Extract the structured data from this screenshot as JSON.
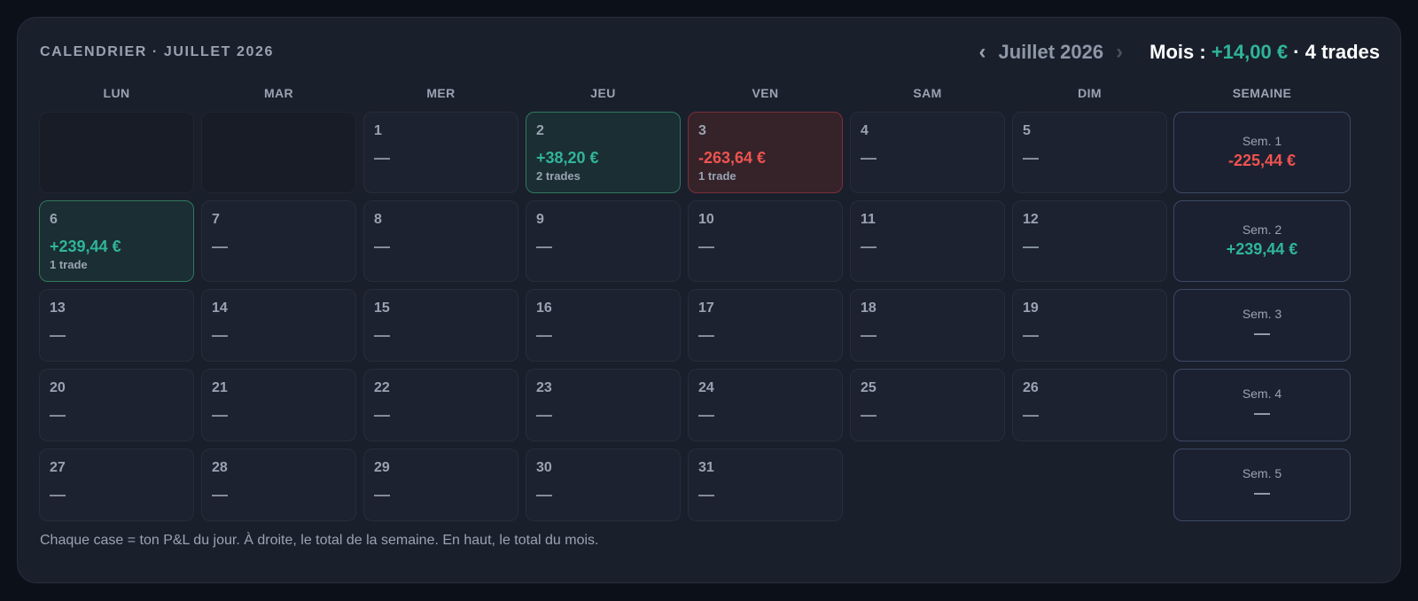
{
  "header": {
    "title": "CALENDRIER · JUILLET 2026",
    "prev_icon": "‹",
    "next_icon": "›",
    "month_label": "Juillet 2026",
    "summary_prefix": "Mois : ",
    "summary_pnl": "+14,00 €",
    "summary_suffix": " · 4 trades"
  },
  "weekdays": [
    "LUN",
    "MAR",
    "MER",
    "JEU",
    "VEN",
    "SAM",
    "DIM"
  ],
  "week_header": "SEMAINE",
  "colors": {
    "positive": "#2fb59a",
    "negative": "#ef5350",
    "background": "#0c1019",
    "card": "#1a1f2c"
  },
  "days": [
    {
      "n": "1",
      "pnl": "—",
      "trades": "",
      "status": "none"
    },
    {
      "n": "2",
      "pnl": "+38,20 €",
      "trades": "2 trades",
      "status": "win"
    },
    {
      "n": "3",
      "pnl": "-263,64 €",
      "trades": "1 trade",
      "status": "loss"
    },
    {
      "n": "4",
      "pnl": "—",
      "trades": "",
      "status": "none"
    },
    {
      "n": "5",
      "pnl": "—",
      "trades": "",
      "status": "none"
    },
    {
      "n": "6",
      "pnl": "+239,44 €",
      "trades": "1 trade",
      "status": "win"
    },
    {
      "n": "7",
      "pnl": "—",
      "trades": "",
      "status": "none"
    },
    {
      "n": "8",
      "pnl": "—",
      "trades": "",
      "status": "none"
    },
    {
      "n": "9",
      "pnl": "—",
      "trades": "",
      "status": "none"
    },
    {
      "n": "10",
      "pnl": "—",
      "trades": "",
      "status": "none"
    },
    {
      "n": "11",
      "pnl": "—",
      "trades": "",
      "status": "none"
    },
    {
      "n": "12",
      "pnl": "—",
      "trades": "",
      "status": "none"
    },
    {
      "n": "13",
      "pnl": "—",
      "trades": "",
      "status": "none"
    },
    {
      "n": "14",
      "pnl": "—",
      "trades": "",
      "status": "none"
    },
    {
      "n": "15",
      "pnl": "—",
      "trades": "",
      "status": "none"
    },
    {
      "n": "16",
      "pnl": "—",
      "trades": "",
      "status": "none"
    },
    {
      "n": "17",
      "pnl": "—",
      "trades": "",
      "status": "none"
    },
    {
      "n": "18",
      "pnl": "—",
      "trades": "",
      "status": "none"
    },
    {
      "n": "19",
      "pnl": "—",
      "trades": "",
      "status": "none"
    },
    {
      "n": "20",
      "pnl": "—",
      "trades": "",
      "status": "none"
    },
    {
      "n": "21",
      "pnl": "—",
      "trades": "",
      "status": "none"
    },
    {
      "n": "22",
      "pnl": "—",
      "trades": "",
      "status": "none"
    },
    {
      "n": "23",
      "pnl": "—",
      "trades": "",
      "status": "none"
    },
    {
      "n": "24",
      "pnl": "—",
      "trades": "",
      "status": "none"
    },
    {
      "n": "25",
      "pnl": "—",
      "trades": "",
      "status": "none"
    },
    {
      "n": "26",
      "pnl": "—",
      "trades": "",
      "status": "none"
    },
    {
      "n": "27",
      "pnl": "—",
      "trades": "",
      "status": "none"
    },
    {
      "n": "28",
      "pnl": "—",
      "trades": "",
      "status": "none"
    },
    {
      "n": "29",
      "pnl": "—",
      "trades": "",
      "status": "none"
    },
    {
      "n": "30",
      "pnl": "—",
      "trades": "",
      "status": "none"
    },
    {
      "n": "31",
      "pnl": "—",
      "trades": "",
      "status": "none"
    }
  ],
  "weeks": [
    {
      "label": "Sem. 1",
      "value": "-225,44 €",
      "status": "neg"
    },
    {
      "label": "Sem. 2",
      "value": "+239,44 €",
      "status": "pos"
    },
    {
      "label": "Sem. 3",
      "value": "—",
      "status": "none"
    },
    {
      "label": "Sem. 4",
      "value": "—",
      "status": "none"
    },
    {
      "label": "Sem. 5",
      "value": "—",
      "status": "none"
    }
  ],
  "footnote": "Chaque case = ton P&L du jour. À droite, le total de la semaine. En haut, le total du mois."
}
